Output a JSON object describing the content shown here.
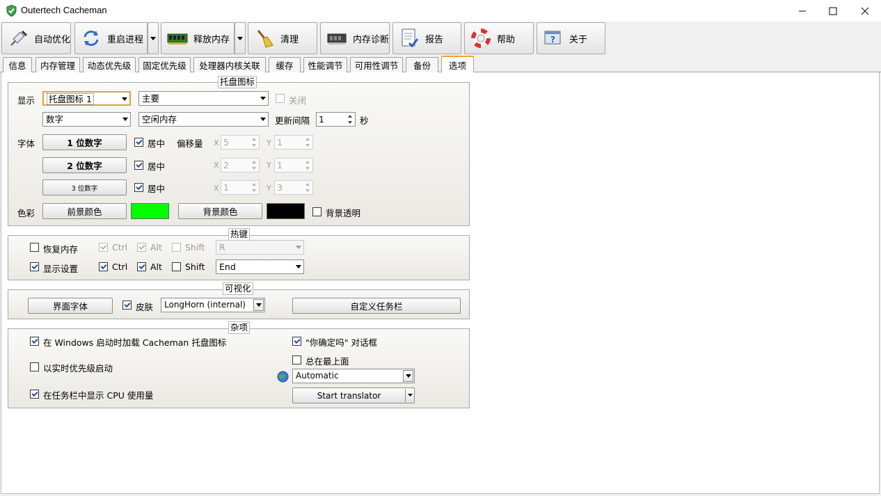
{
  "window": {
    "title": "Outertech Cacheman",
    "controls": [
      "minimize",
      "maximize",
      "close"
    ]
  },
  "toolbar": {
    "buttons": [
      {
        "label": "自动优化",
        "icon": "syringe-icon"
      },
      {
        "label": "重启进程",
        "icon": "restart-arrows-icon"
      },
      {
        "label": "释放内存",
        "icon": "memory-chip-icon"
      },
      {
        "label": "清理",
        "icon": "broom-icon"
      },
      {
        "label": "内存诊断",
        "icon": "chip-diagnostics-icon"
      },
      {
        "label": "报告",
        "icon": "report-document-icon"
      },
      {
        "label": "帮助",
        "icon": "lifebuoy-icon"
      },
      {
        "label": "关于",
        "icon": "about-window-icon"
      }
    ]
  },
  "tabs": [
    "信息",
    "内存管理",
    "动态优先级",
    "固定优先级",
    "处理器内核关联",
    "缓存",
    "性能调节",
    "可用性调节",
    "备份",
    "选项"
  ],
  "active_tab": "选项",
  "tray": {
    "title": "托盘图标",
    "display_label": "显示",
    "icon_select": "托盘图标 1",
    "main_select": "主要",
    "off_label": "关闭",
    "off_checked": false,
    "type_select": "数字",
    "source_select": "空闲内存",
    "interval_label": "更新间隔",
    "interval_value": "1",
    "interval_unit": "秒",
    "font_label": "字体",
    "offset_label": "偏移量",
    "x_label": "X",
    "y_label": "Y",
    "rows": [
      {
        "font_button": "1 位数字",
        "center_label": "居中",
        "center_checked": true,
        "x": "5",
        "y": "1"
      },
      {
        "font_button": "2 位数字",
        "center_label": "居中",
        "center_checked": true,
        "x": "2",
        "y": "1"
      },
      {
        "font_button": "3 位数字",
        "center_label": "居中",
        "center_checked": true,
        "x": "1",
        "y": "3"
      }
    ],
    "color_label": "色彩",
    "fg_button": "前景颜色",
    "fg_color": "#00ff00",
    "bg_button": "背景颜色",
    "bg_color": "#000000",
    "transparent_label": "背景透明",
    "transparent_checked": false
  },
  "hotkeys": {
    "title": "热键",
    "rows": [
      {
        "label": "恢复内存",
        "checked": false,
        "ctrl": "Ctrl",
        "ctrl_checked": true,
        "alt": "Alt",
        "alt_checked": true,
        "shift": "Shift",
        "shift_checked": false,
        "key": "R",
        "enabled": false
      },
      {
        "label": "显示设置",
        "checked": true,
        "ctrl": "Ctrl",
        "ctrl_checked": true,
        "alt": "Alt",
        "alt_checked": true,
        "shift": "Shift",
        "shift_checked": false,
        "key": "End",
        "enabled": true
      }
    ]
  },
  "visual": {
    "title": "可视化",
    "font_button": "界面字体",
    "skin_label": "皮肤",
    "skin_checked": true,
    "skin_select": "LongHorn (internal)",
    "taskbar_button": "自定义任务栏"
  },
  "misc": {
    "title": "杂项",
    "load_tray": "在 Windows 启动时加载 Cacheman 托盘图标",
    "load_tray_checked": true,
    "realtime": "以实时优先级启动",
    "realtime_checked": false,
    "cpu_usage": "在任务栏中显示 CPU 使用量",
    "cpu_usage_checked": true,
    "confirm_dialog": "\"你确定吗\" 对话框",
    "confirm_checked": true,
    "always_top": "总在最上面",
    "always_top_checked": false,
    "language_icon": "globe-icon",
    "language_select": "Automatic",
    "translator_button": "Start translator"
  }
}
